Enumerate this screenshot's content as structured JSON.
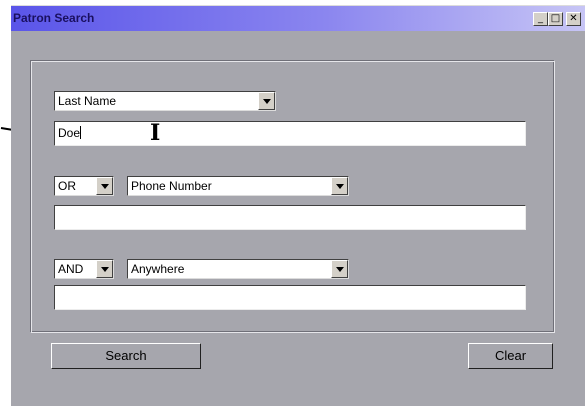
{
  "window": {
    "title": "Patron Search",
    "controls": {
      "minimize": "_",
      "maximize": "□",
      "close": "✕"
    }
  },
  "row1": {
    "field": {
      "selected": "Last Name"
    },
    "value": "Doe"
  },
  "row2": {
    "operator": {
      "selected": "OR"
    },
    "field": {
      "selected": "Phone Number"
    },
    "value": ""
  },
  "row3": {
    "operator": {
      "selected": "AND"
    },
    "field": {
      "selected": "Anywhere"
    },
    "value": ""
  },
  "buttons": {
    "search": "Search",
    "clear": "Clear"
  },
  "cursor": {
    "glyph": "I"
  },
  "colors": {
    "titlebar_start": "#5a55e9",
    "titlebar_end": "#c7c5f5",
    "window_bg": "#a6a6ad"
  }
}
